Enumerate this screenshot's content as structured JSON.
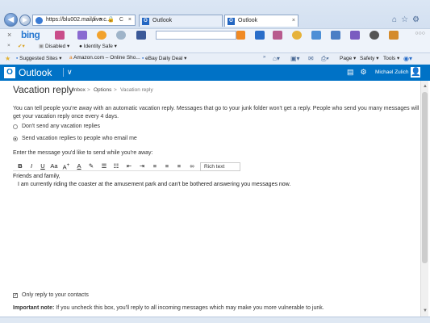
{
  "browser": {
    "address": "https://blu002.mail.live.c...",
    "address_controls": "ρ ▾ 🔒 C ×",
    "tabs": [
      {
        "label": "Outlook"
      },
      {
        "label": "Outlook"
      }
    ],
    "bing_label": "bing",
    "favorites": {
      "suggested_sites": "Suggested Sites ▾",
      "amazon": "Amazon.com – Online Sho...",
      "ebay": "eBay Daily Deal ▾"
    },
    "toolbar2": {
      "disabled": "Disabled ▾",
      "identity_safe": "Identity Safe ▾"
    },
    "commands": {
      "page": "Page ▾",
      "safety": "Safety ▾",
      "tools": "Tools ▾"
    }
  },
  "outlook": {
    "app_name": "Outlook",
    "user_name": "Michael Zulich"
  },
  "settings": {
    "title": "Vacation reply",
    "breadcrumb": [
      "Inbox",
      ">",
      "Options",
      ">",
      "Vacation reply"
    ],
    "info_text": "You can tell people you're away with an automatic vacation reply. Messages that go to your junk folder won't get a reply. People who send you many messages will get your vacation reply once every 4 days.",
    "option_dont_send": "Don't send any vacation replies",
    "option_send": "Send vacation replies to people who email me",
    "prompt": "Enter the message you'd like to send while you're away:",
    "editor_format": "Rich text",
    "message_line1": "Friends and family,",
    "message_line2": "I am currently riding the coaster at the amusement park and can't be bothered answering you messages now.",
    "only_contacts_label": "Only reply to your contacts",
    "important_label": "Important note:",
    "important_text": " If you uncheck this box, you'll reply to all incoming messages which may make you more vulnerable to junk."
  },
  "colors": {
    "brand": "#0072c6",
    "bing": "#2a7ad1"
  }
}
